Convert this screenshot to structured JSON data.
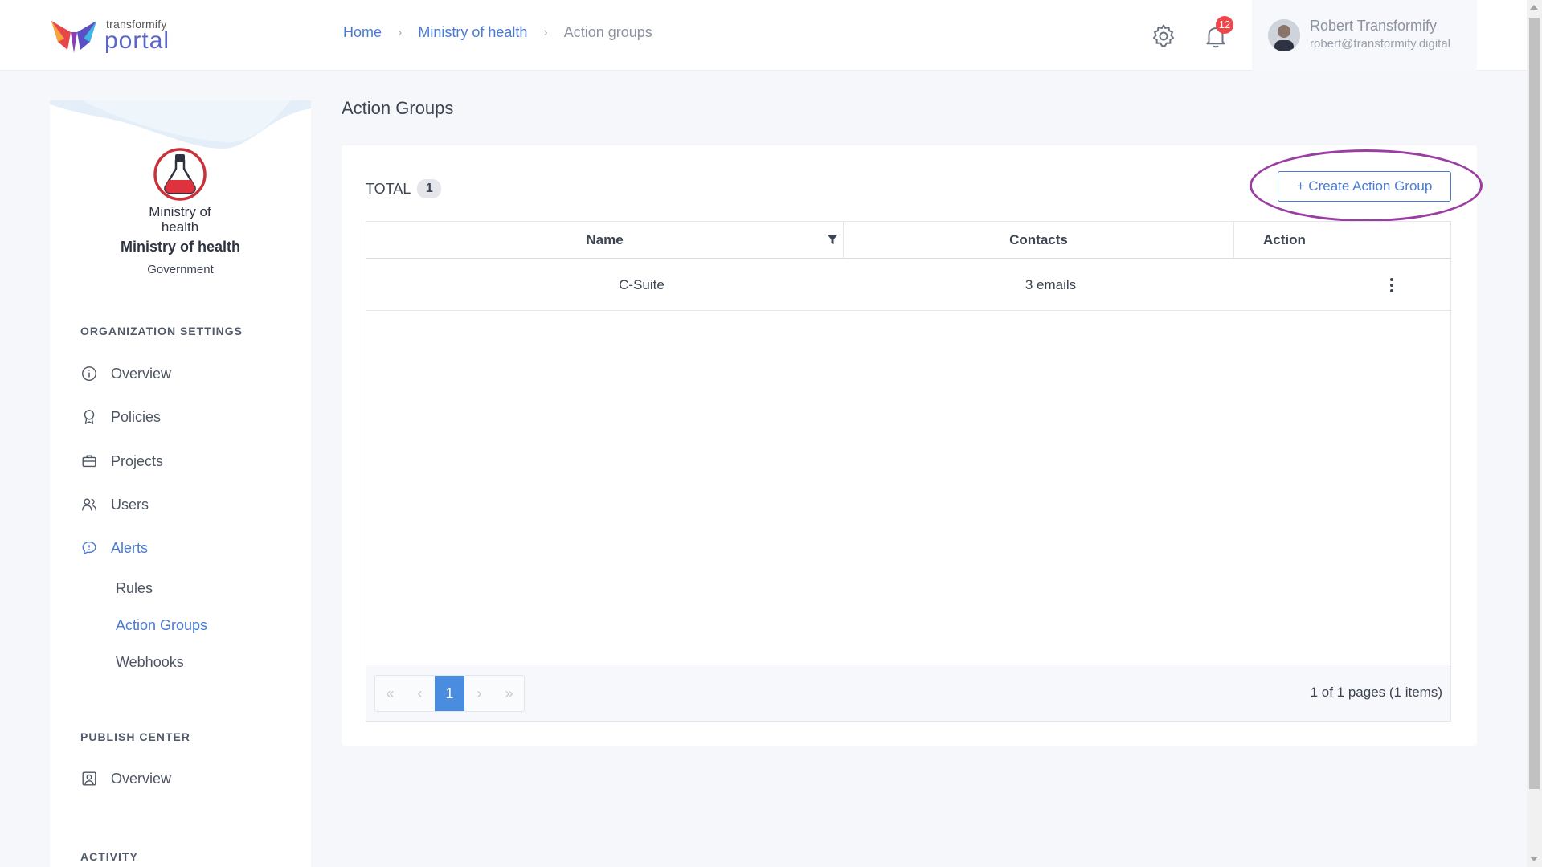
{
  "header": {
    "logo_small": "transformify",
    "logo_big": "portal",
    "breadcrumb": [
      "Home",
      "Ministry of health",
      "Action groups"
    ],
    "notification_count": "12",
    "user_name": "Robert Transformify",
    "user_email": "robert@transformify.digital"
  },
  "sidebar": {
    "org_name": "Ministry of health",
    "org_type": "Government",
    "org_logo_text": [
      "Ministry of",
      "health"
    ],
    "section_org": "ORGANIZATION SETTINGS",
    "items": [
      "Overview",
      "Policies",
      "Projects",
      "Users",
      "Alerts"
    ],
    "alerts_sub": [
      "Rules",
      "Action Groups",
      "Webhooks"
    ],
    "section_publish": "PUBLISH CENTER",
    "publish_items": [
      "Overview"
    ],
    "section_activity": "ACTIVITY"
  },
  "main": {
    "title": "Action Groups",
    "total_label": "TOTAL",
    "total_count": "1",
    "create_button": "+ Create Action Group",
    "columns": [
      "Name",
      "Contacts",
      "Action"
    ],
    "rows": [
      {
        "name": "C-Suite",
        "contacts": "3 emails"
      }
    ],
    "pager": {
      "current_page": "1",
      "info": "1 of 1 pages (1 items)"
    }
  },
  "colors": {
    "accent": "#4a7bd0",
    "highlight": "#9b3ea3",
    "badge": "#f0464a"
  }
}
